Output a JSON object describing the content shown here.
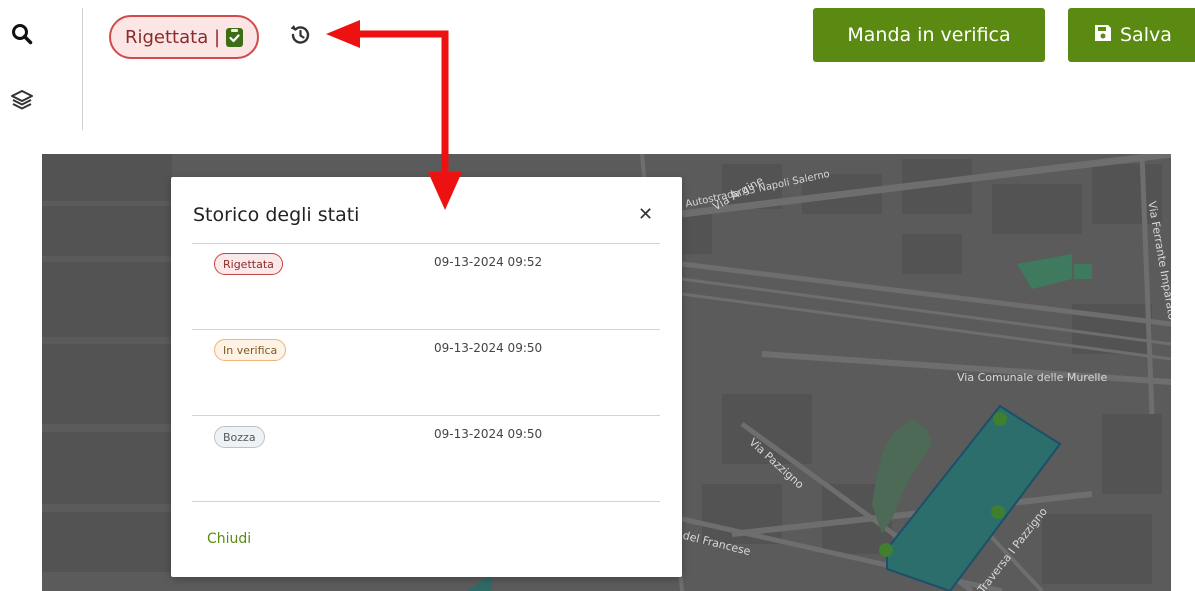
{
  "toolbar": {
    "search_icon": "search-icon",
    "layers_icon": "layers-icon"
  },
  "status": {
    "label": "Rigettata |",
    "icon": "clipboard-check-icon",
    "color": "#d24b4b"
  },
  "history_icon": "history-icon",
  "header": {
    "verify_label": "Manda in verifica",
    "save_label": "Salva",
    "save_icon": "floppy-disk-icon",
    "accent": "#5b8a12"
  },
  "map": {
    "streets": [
      "Via Argine",
      "Autostrada A3 Napoli Salerno",
      "Via Ferrante Imparato",
      "Via Comunale delle Murelle",
      "Via Pazzigno",
      "Traversa I Pazzigno",
      "del Francese"
    ]
  },
  "modal": {
    "title": "Storico degli stati",
    "close_icon": "close-icon",
    "entries": [
      {
        "status": "Rigettata",
        "date": "09-13-2024 09:52"
      },
      {
        "status": "In verifica",
        "date": "09-13-2024 09:50"
      },
      {
        "status": "Bozza",
        "date": "09-13-2024 09:50"
      }
    ],
    "close_link": "Chiudi"
  }
}
